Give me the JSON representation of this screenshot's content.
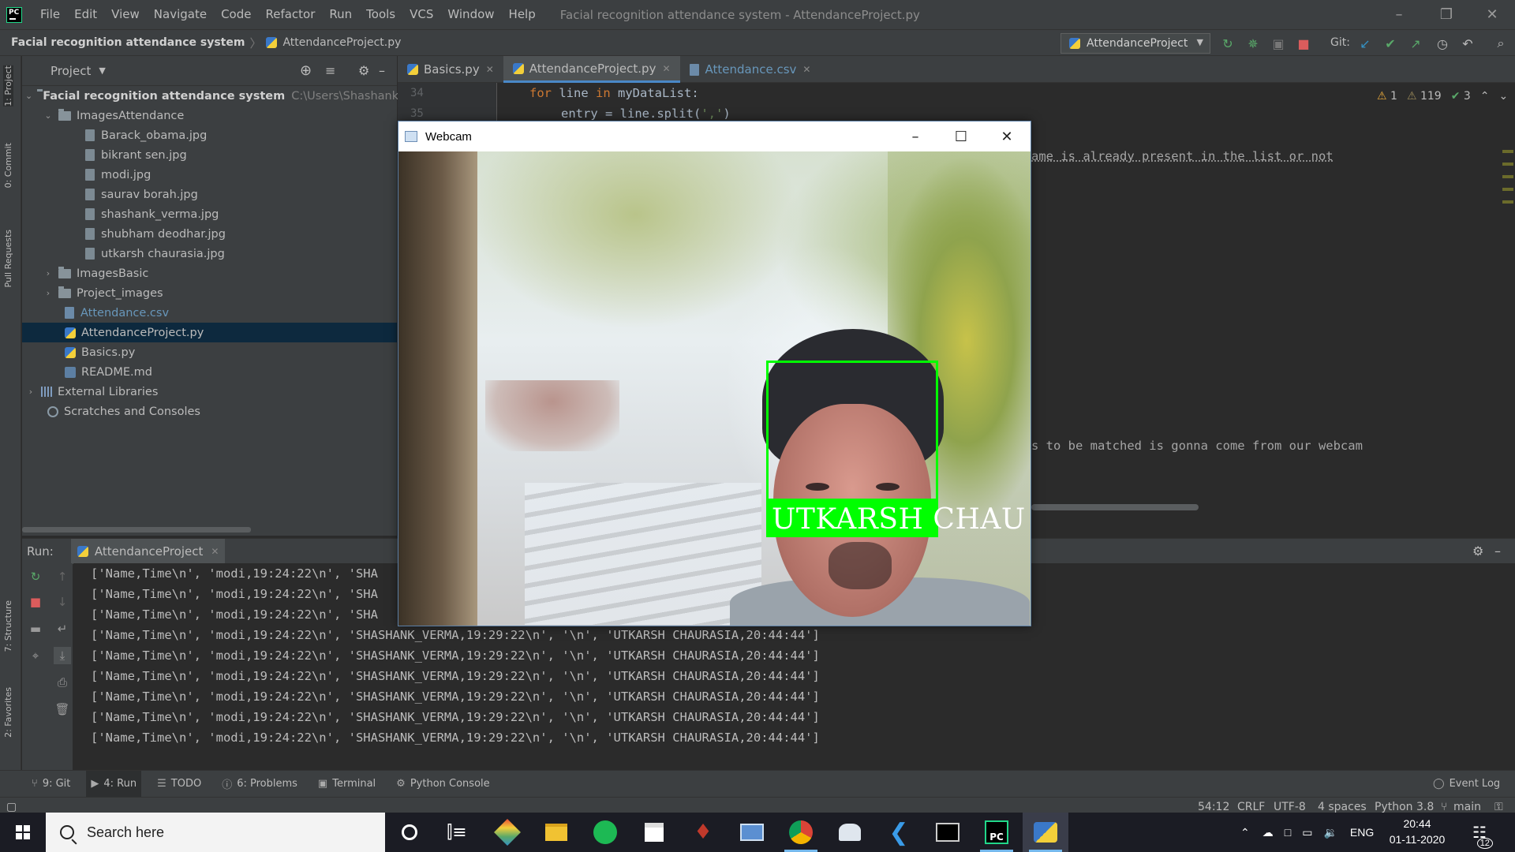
{
  "menu": {
    "items": [
      "File",
      "Edit",
      "View",
      "Navigate",
      "Code",
      "Refactor",
      "Run",
      "Tools",
      "VCS",
      "Window",
      "Help"
    ],
    "window_title": "Facial recognition attendance system - AttendanceProject.py"
  },
  "navbar": {
    "project": "Facial recognition attendance system",
    "file": "AttendanceProject.py",
    "run_config": "AttendanceProject",
    "git_label": "Git:"
  },
  "left_strip": {
    "project_tab": "1: Project",
    "commit_tab": "0: Commit",
    "pull_tab": "Pull Requests",
    "structure_tab": "7: Structure",
    "favorites_tab": "2: Favorites"
  },
  "project_panel": {
    "title": "Project",
    "root": "Facial recognition attendance system",
    "root_path": "C:\\Users\\Shashank Verma",
    "folder_images_attendance": "ImagesAttendance",
    "images": [
      "Barack_obama.jpg",
      "bikrant sen.jpg",
      "modi.jpg",
      "saurav borah.jpg",
      "shashank_verma.jpg",
      "shubham deodhar.jpg",
      "utkarsh chaurasia.jpg"
    ],
    "folder_images_basic": "ImagesBasic",
    "folder_project_images": "Project_images",
    "file_csv": "Attendance.csv",
    "file_attendance_py": "AttendanceProject.py",
    "file_basics_py": "Basics.py",
    "file_readme": "README.md",
    "external_libraries": "External Libraries",
    "scratches": "Scratches and Consoles"
  },
  "editor": {
    "tabs": [
      "Basics.py",
      "AttendanceProject.py",
      "Attendance.csv"
    ],
    "line_numbers": [
      "34",
      "35"
    ],
    "line34_kw1": "for",
    "line34_mid": " line ",
    "line34_kw2": "in",
    "line34_rest": " myDataList:",
    "line35_pre": "entry = line.split(",
    "line35_str": "','",
    "line35_post": ")",
    "comment_fragment_1": "ame is already present in the list or not",
    "comment_fragment_2": "s to be matched is gonna come from our webcam",
    "warnings": {
      "warn_count": "1",
      "weak_warn_count": "119",
      "typo_count": "3"
    }
  },
  "run_panel": {
    "label": "Run:",
    "tab": "AttendanceProject",
    "partial_lines": [
      "['Name,Time\\n', 'modi,19:24:22\\n', 'SHA",
      "['Name,Time\\n', 'modi,19:24:22\\n', 'SHA",
      "['Name,Time\\n', 'modi,19:24:22\\n', 'SHA"
    ],
    "full_lines": [
      "['Name,Time\\n', 'modi,19:24:22\\n', 'SHASHANK_VERMA,19:29:22\\n', '\\n', 'UTKARSH CHAURASIA,20:44:44']",
      "['Name,Time\\n', 'modi,19:24:22\\n', 'SHASHANK_VERMA,19:29:22\\n', '\\n', 'UTKARSH CHAURASIA,20:44:44']",
      "['Name,Time\\n', 'modi,19:24:22\\n', 'SHASHANK_VERMA,19:29:22\\n', '\\n', 'UTKARSH CHAURASIA,20:44:44']",
      "['Name,Time\\n', 'modi,19:24:22\\n', 'SHASHANK_VERMA,19:29:22\\n', '\\n', 'UTKARSH CHAURASIA,20:44:44']",
      "['Name,Time\\n', 'modi,19:24:22\\n', 'SHASHANK_VERMA,19:29:22\\n', '\\n', 'UTKARSH CHAURASIA,20:44:44']",
      "['Name,Time\\n', 'modi,19:24:22\\n', 'SHASHANK_VERMA,19:29:22\\n', '\\n', 'UTKARSH CHAURASIA,20:44:44']"
    ]
  },
  "toolwindows": {
    "git": "9: Git",
    "run": "4: Run",
    "todo": "TODO",
    "problems": "6: Problems",
    "terminal": "Terminal",
    "python_console": "Python Console",
    "event_log": "Event Log"
  },
  "status": {
    "position": "54:12",
    "line_sep": "CRLF",
    "encoding": "UTF-8",
    "indent": "4 spaces",
    "interpreter": "Python 3.8",
    "branch": "main"
  },
  "webcam": {
    "title": "Webcam",
    "label_name": "UTKARSH",
    "label_surname_partial": "CHAU",
    "box_color": "#00ff00"
  },
  "taskbar": {
    "search_placeholder": "Search here",
    "language": "ENG",
    "time": "20:44",
    "date": "01-11-2020",
    "notification_count": "12"
  }
}
